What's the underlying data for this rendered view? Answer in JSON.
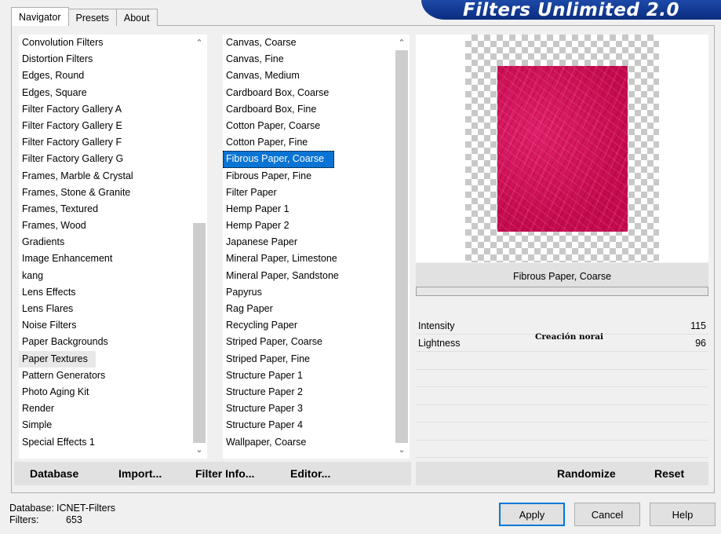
{
  "tabs": [
    "Navigator",
    "Presets",
    "About"
  ],
  "banner_title": "Filters Unlimited 2.0",
  "categories": [
    "Convolution Filters",
    "Distortion Filters",
    "Edges, Round",
    "Edges, Square",
    "Filter Factory Gallery A",
    "Filter Factory Gallery E",
    "Filter Factory Gallery F",
    "Filter Factory Gallery G",
    "Frames, Marble & Crystal",
    "Frames, Stone & Granite",
    "Frames, Textured",
    "Frames, Wood",
    "Gradients",
    "Image Enhancement",
    "kang",
    "Lens Effects",
    "Lens Flares",
    "Noise Filters",
    "Paper Backgrounds",
    "Paper Textures",
    "Pattern Generators",
    "Photo Aging Kit",
    "Render",
    "Simple",
    "Special Effects 1"
  ],
  "selected_category": "Paper Textures",
  "filters": [
    "Canvas, Coarse",
    "Canvas, Fine",
    "Canvas, Medium",
    "Cardboard Box, Coarse",
    "Cardboard Box, Fine",
    "Cotton Paper, Coarse",
    "Cotton Paper, Fine",
    "Fibrous Paper, Coarse",
    "Fibrous Paper, Fine",
    "Filter Paper",
    "Hemp Paper 1",
    "Hemp Paper 2",
    "Japanese Paper",
    "Mineral Paper, Limestone",
    "Mineral Paper, Sandstone",
    "Papyrus",
    "Rag Paper",
    "Recycling Paper",
    "Striped Paper, Coarse",
    "Striped Paper, Fine",
    "Structure Paper 1",
    "Structure Paper 2",
    "Structure Paper 3",
    "Structure Paper 4",
    "Wallpaper, Coarse"
  ],
  "selected_filter": "Fibrous Paper, Coarse",
  "left_buttons": {
    "database": "Database",
    "import": "Import...",
    "filter_info": "Filter Info...",
    "editor": "Editor..."
  },
  "right_buttons": {
    "randomize": "Randomize",
    "reset": "Reset"
  },
  "preview": {
    "filter_name": "Fibrous Paper, Coarse",
    "texture_color": "#d0125a"
  },
  "params": [
    {
      "label": "Intensity",
      "value": "115"
    },
    {
      "label": "Lightness",
      "value": "96"
    }
  ],
  "watermark": "Creación norai",
  "status": {
    "database_label": "Database:",
    "database_value": "ICNET-Filters",
    "filters_label": "Filters:",
    "filters_value": "653"
  },
  "dialog_buttons": {
    "apply": "Apply",
    "cancel": "Cancel",
    "help": "Help"
  }
}
